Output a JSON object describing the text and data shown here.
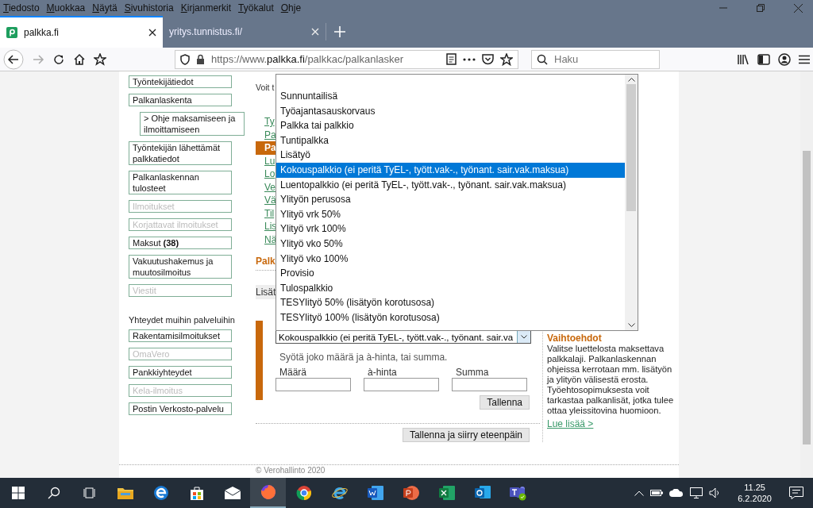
{
  "menu_bar": {
    "items": [
      "Tiedosto",
      "Muokkaa",
      "Näytä",
      "Sivuhistoria",
      "Kirjanmerkit",
      "Työkalut",
      "Ohje"
    ]
  },
  "tabs": [
    {
      "label": "palkka.fi",
      "selected": true
    },
    {
      "label": "yritys.tunnistus.fi/",
      "selected": false
    }
  ],
  "address_bar": {
    "scheme": "https://www.",
    "domain": "palkka.fi",
    "path": "/palkkac/palkanlasker"
  },
  "search": {
    "placeholder": "Haku"
  },
  "sidebar": {
    "items": [
      {
        "label": "Työntekijätiedot",
        "disabled": false
      },
      {
        "label": "Palkanlaskenta",
        "disabled": false,
        "children": [
          {
            "label": "> Ohje maksamiseen ja ilmoittamiseen",
            "disabled": false
          }
        ]
      },
      {
        "label": "Työntekijän lähettämät palkkatiedot",
        "disabled": false
      },
      {
        "label": "Palkanlaskennan tulosteet",
        "disabled": false
      },
      {
        "label": "Ilmoitukset",
        "disabled": true
      },
      {
        "label": "Korjattavat ilmoitukset",
        "disabled": true
      },
      {
        "label": "Maksut **(38)**",
        "disabled": false
      },
      {
        "label": "Vakuutushakemus ja muutosilmoitus",
        "disabled": false
      },
      {
        "label": "Viestit",
        "disabled": true
      }
    ],
    "heading": "Yhteydet muihin palveluihin",
    "links": [
      {
        "label": "Rakentamisilmoitukset",
        "disabled": false
      },
      {
        "label": "OmaVero",
        "disabled": true
      },
      {
        "label": "Pankkiyhteydet",
        "disabled": false
      },
      {
        "label": "Kela-ilmoitus",
        "disabled": true
      },
      {
        "label": "Postin Verkosto-palvelu",
        "disabled": false
      }
    ]
  },
  "main": {
    "intro": "Voit t",
    "steps": [
      {
        "label": "Ty",
        "selected": false
      },
      {
        "label": "Pa",
        "selected": false
      },
      {
        "label": "Pa",
        "selected": true
      },
      {
        "label": "Lu",
        "selected": false
      },
      {
        "label": "Lo",
        "selected": false
      },
      {
        "label": "Ve",
        "selected": false
      },
      {
        "label": "Vä",
        "selected": false
      },
      {
        "label": "Til",
        "selected": false
      },
      {
        "label": "Lis",
        "selected": false
      },
      {
        "label": "Nä",
        "selected": false
      }
    ],
    "section_title": "Palk",
    "subsection": "Lisät"
  },
  "dropdown": {
    "options": [
      {
        "label": "Sunnuntailisä",
        "selected": false
      },
      {
        "label": "Työajantasauskorvaus",
        "selected": false
      },
      {
        "label": "Palkka tai palkkio",
        "selected": false
      },
      {
        "label": "Tuntipalkka",
        "selected": false
      },
      {
        "label": "Lisätyö",
        "selected": false
      },
      {
        "label": "Kokouspalkkio (ei peritä TyEL-, tyött.vak-., työnant. sair.vak.maksua)",
        "selected": true
      },
      {
        "label": "Luentopalkkio (ei peritä TyEL-, tyött.vak-., työnant. sair.vak.maksua)",
        "selected": false
      },
      {
        "label": "Ylityön perusosa",
        "selected": false
      },
      {
        "label": "Ylityö vrk 50%",
        "selected": false
      },
      {
        "label": "Ylityö vrk 100%",
        "selected": false
      },
      {
        "label": "Ylityö vko 50%",
        "selected": false
      },
      {
        "label": "Ylityö vko 100%",
        "selected": false
      },
      {
        "label": "Provisio",
        "selected": false
      },
      {
        "label": "Tulospalkkio",
        "selected": false
      },
      {
        "label": "TESYlityö 50% (lisätyön korotusosa)",
        "selected": false
      },
      {
        "label": "TESYlityö 100% (lisätyön korotusosa)",
        "selected": false
      }
    ]
  },
  "select": {
    "value": "Kokouspalkkio (ei peritä TyEL-, tyött.vak-., työnant. sair.va"
  },
  "form": {
    "hint": "Syötä joko määrä ja à-hinta, tai summa.",
    "fields": [
      {
        "label": "Määrä"
      },
      {
        "label": "à-hinta"
      },
      {
        "label": "Summa"
      }
    ],
    "save_button": "Tallenna",
    "next_button": "Tallenna ja siirry eteenpäin"
  },
  "aside": {
    "title": "Vaihtoehdot",
    "text": "Valitse luettelosta maksettava palkkalaji. Palkanlaskennan ohjeissa kerrotaan mm. lisätyön ja ylityön välisestä erosta. Työehtosopimuksesta voit tarkastaa palkanlisät, jotka tulee ottaa yleissitovina huomioon.",
    "link": "Lue lisää >"
  },
  "footer": {
    "copyright": "© Verohallinto 2020"
  },
  "taskbar": {
    "time": "11.25",
    "date": "6.2.2020"
  }
}
